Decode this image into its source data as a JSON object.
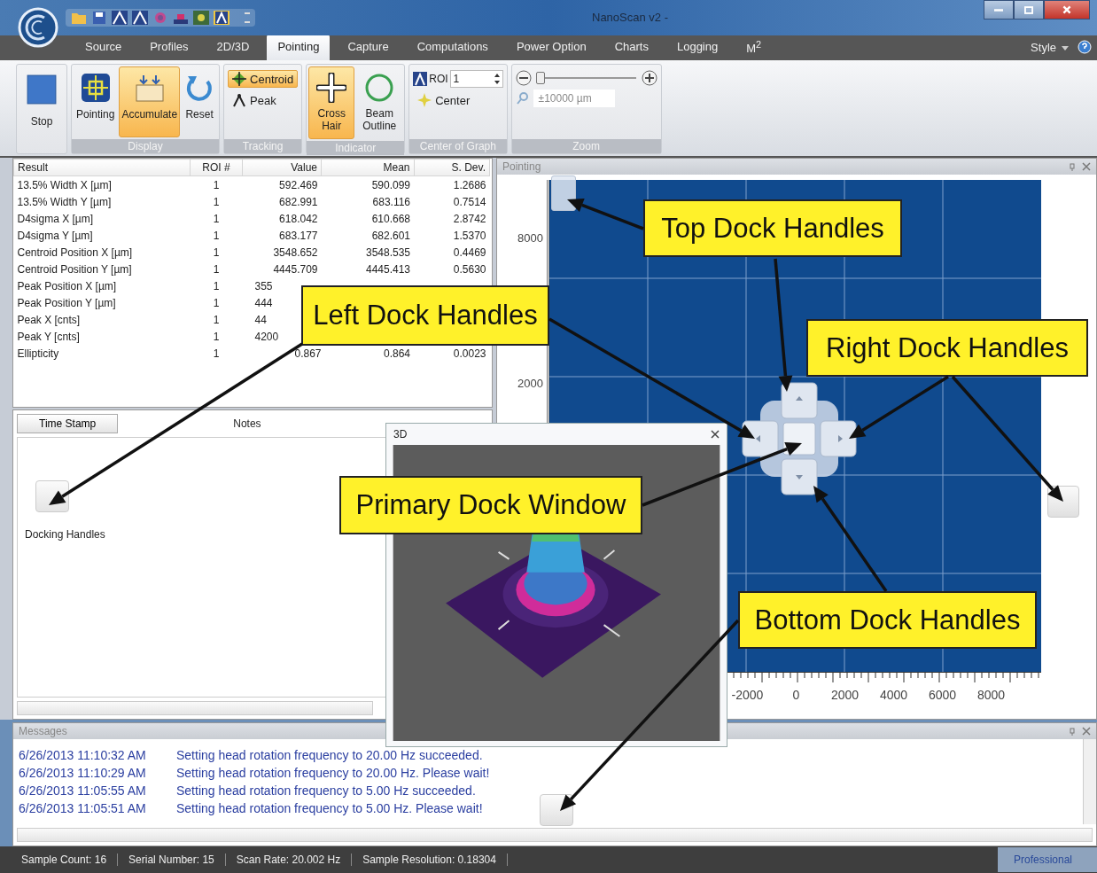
{
  "window": {
    "title": "NanoScan v2 -"
  },
  "tabs": [
    {
      "label": "Source",
      "selected": false
    },
    {
      "label": "Profiles",
      "selected": false
    },
    {
      "label": "2D/3D",
      "selected": false
    },
    {
      "label": "Pointing",
      "selected": true
    },
    {
      "label": "Capture",
      "selected": false
    },
    {
      "label": "Computations",
      "selected": false
    },
    {
      "label": "Power Option",
      "selected": false
    },
    {
      "label": "Charts",
      "selected": false
    },
    {
      "label": "Logging",
      "selected": false
    },
    {
      "label": "M$^{2}$",
      "selected": false
    }
  ],
  "style_menu": {
    "label": "Style"
  },
  "ribbon": {
    "stop": {
      "label": "Stop"
    },
    "display": {
      "title": "Display",
      "buttons": [
        {
          "label": "Pointing",
          "kind": "pointing",
          "selected": false
        },
        {
          "label": "Accumulate",
          "kind": "accumulate",
          "selected": true
        },
        {
          "label": "Reset",
          "kind": "reset",
          "selected": false
        }
      ]
    },
    "tracking": {
      "title": "Tracking",
      "options": [
        {
          "label": "Centroid",
          "kind": "centroid",
          "selected": true
        },
        {
          "label": "Peak",
          "kind": "peak",
          "selected": false
        }
      ]
    },
    "indicator": {
      "title": "Indicator",
      "buttons": [
        {
          "label": "Cross Hair",
          "kind": "crosshair",
          "selected": true
        },
        {
          "label": "Beam Outline",
          "kind": "outline",
          "selected": false
        }
      ]
    },
    "center_of_graph": {
      "title": "Center of Graph",
      "roi_label": "ROI",
      "roi_value": "1",
      "center_label": "Center"
    },
    "zoom": {
      "title": "Zoom",
      "level": 0.03,
      "value": "±10000 µm"
    }
  },
  "results": {
    "columns": [
      "Result",
      "ROI #",
      "Value",
      "Mean",
      "S. Dev."
    ],
    "rows": [
      [
        "13.5% Width X [µm]",
        "1",
        "592.469",
        "590.099",
        "1.2686"
      ],
      [
        "13.5% Width Y [µm]",
        "1",
        "682.991",
        "683.116",
        "0.7514"
      ],
      [
        "D4sigma X [µm]",
        "1",
        "618.042",
        "610.668",
        "2.8742"
      ],
      [
        "D4sigma Y [µm]",
        "1",
        "683.177",
        "682.601",
        "1.5370"
      ],
      [
        "Centroid Position X [µm]",
        "1",
        "3548.652",
        "3548.535",
        "0.4469"
      ],
      [
        "Centroid Position Y [µm]",
        "1",
        "4445.709",
        "4445.413",
        "0.5630"
      ],
      [
        "Peak Position X [µm]",
        "1",
        "355"
      ],
      [
        "Peak Position Y [µm]",
        "1",
        "444"
      ],
      [
        "Peak X [cnts]",
        "1",
        "44"
      ],
      [
        "Peak Y [cnts]",
        "1",
        "4200"
      ],
      [
        "Ellipticity",
        "1",
        "0.867",
        "0.864",
        "0.0023"
      ]
    ]
  },
  "notes": {
    "columns": [
      "Time Stamp",
      "Notes"
    ],
    "docking_label": "Docking Handles"
  },
  "pointing": {
    "title": "Pointing",
    "y_ticks": [
      "8000",
      "2000"
    ],
    "x_ticks": [
      "-2000",
      "0",
      "2000",
      "4000",
      "6000",
      "8000"
    ]
  },
  "float_window": {
    "title": "3D"
  },
  "callouts": [
    {
      "text": "Top Dock Handles"
    },
    {
      "text": "Left Dock Handles"
    },
    {
      "text": "Right Dock Handles"
    },
    {
      "text": "Primary Dock Window"
    },
    {
      "text": "Bottom Dock Handles"
    }
  ],
  "messages": {
    "title": "Messages",
    "rows": [
      {
        "time": "6/26/2013 11:10:32 AM",
        "text": "Setting head rotation frequency to 20.00 Hz succeeded."
      },
      {
        "time": "6/26/2013 11:10:29 AM",
        "text": "Setting head rotation frequency to 20.00 Hz. Please wait!"
      },
      {
        "time": "6/26/2013 11:05:55 AM",
        "text": "Setting head rotation frequency to 5.00 Hz succeeded."
      },
      {
        "time": "6/26/2013 11:05:51 AM",
        "text": "Setting head rotation frequency to 5.00 Hz. Please wait!"
      }
    ]
  },
  "status_bar": {
    "items": [
      "Sample Count: 16",
      "Serial Number: 15",
      "Scan Rate: 20.002 Hz",
      "Sample Resolution: 0.18304"
    ],
    "edition": "Professional"
  }
}
